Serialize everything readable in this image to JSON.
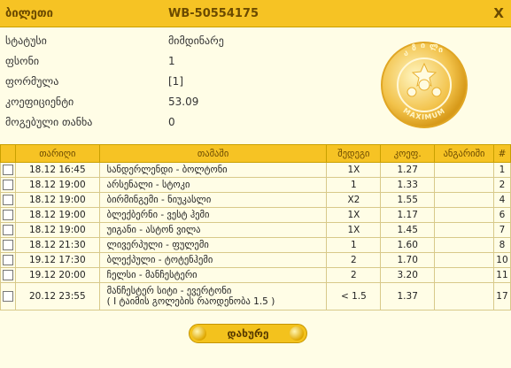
{
  "header": {
    "ticket_label": "ბილეთი",
    "ticket_id": "WB-50554175",
    "close_glyph": "X"
  },
  "info": [
    {
      "key": "სტატუსი",
      "value": "მიმდინარე"
    },
    {
      "key": "ფსონი",
      "value": "1"
    },
    {
      "key": "ფორმულა",
      "value": "[1]"
    },
    {
      "key": "კოეფიციენტი",
      "value": "53.09"
    },
    {
      "key": "მოგებული თანხა",
      "value": "0"
    }
  ],
  "logo": {
    "text": "MAXIMUM"
  },
  "table": {
    "headers": {
      "date": "თარიღი",
      "game": "თამაში",
      "result": "შედეგი",
      "odds": "კოეფ.",
      "calc": "ანგარიში",
      "num": "#"
    },
    "rows": [
      {
        "date": "18.12 16:45",
        "game": "სანდერლენდი - ბოლტონი",
        "result": "1X",
        "odds": "1.27",
        "calc": "",
        "num": "1"
      },
      {
        "date": "18.12 19:00",
        "game": "არსენალი - სტოკი",
        "result": "1",
        "odds": "1.33",
        "calc": "",
        "num": "2"
      },
      {
        "date": "18.12 19:00",
        "game": "ბირმინგემი - ნიუკასლი",
        "result": "X2",
        "odds": "1.55",
        "calc": "",
        "num": "4"
      },
      {
        "date": "18.12 19:00",
        "game": "ბლექბერნი - ვესტ ჰემი",
        "result": "1X",
        "odds": "1.17",
        "calc": "",
        "num": "6"
      },
      {
        "date": "18.12 19:00",
        "game": "უიგანი - ასტონ ვილა",
        "result": "1X",
        "odds": "1.45",
        "calc": "",
        "num": "7"
      },
      {
        "date": "18.12 21:30",
        "game": "ლივერპული - ფულემი",
        "result": "1",
        "odds": "1.60",
        "calc": "",
        "num": "8"
      },
      {
        "date": "19.12 17:30",
        "game": "ბლექპული - ტოტენჰემი",
        "result": "2",
        "odds": "1.70",
        "calc": "",
        "num": "10"
      },
      {
        "date": "19.12 20:00",
        "game": "ჩელსი - მანჩესტერი",
        "result": "2",
        "odds": "3.20",
        "calc": "",
        "num": "11"
      },
      {
        "date": "20.12 23:55",
        "game": "მანჩესტერ სიტი - ევერტონი",
        "game_note": "( I ტაიმის გოლების რაოდენობა 1.5 )",
        "result": "< 1.5",
        "odds": "1.37",
        "calc": "",
        "num": "17"
      }
    ]
  },
  "buttons": {
    "close": "დახურე"
  }
}
